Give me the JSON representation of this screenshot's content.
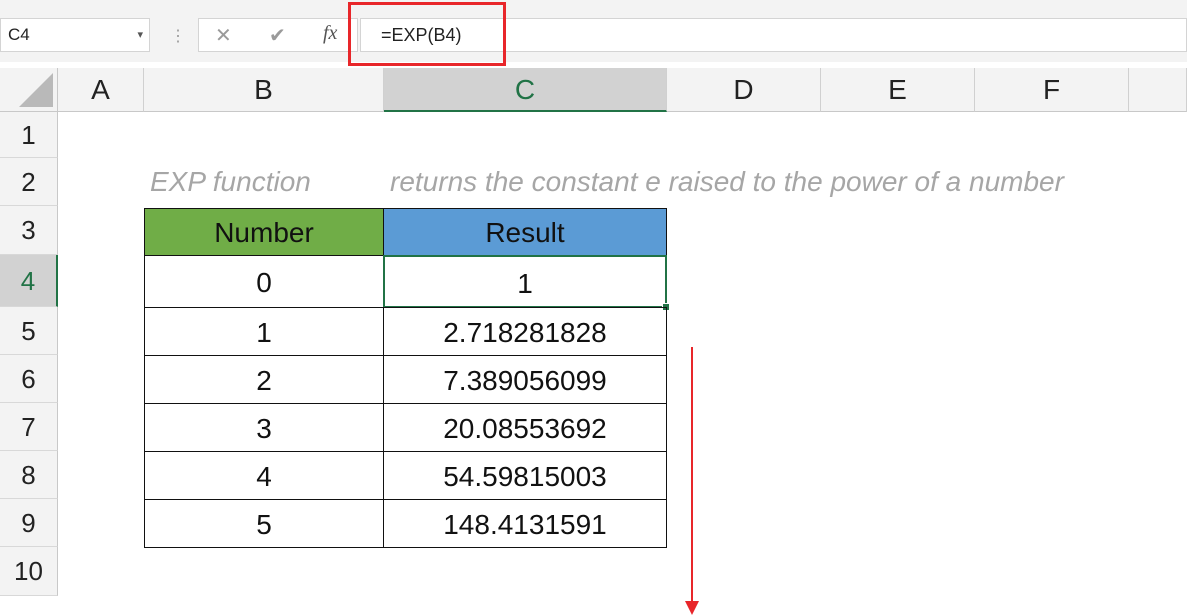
{
  "formula_bar": {
    "name_box": "C4",
    "name_box_arrow": "▾",
    "divider_dots": "⋮",
    "cancel_glyph": "✕",
    "enter_glyph": "✔",
    "fx_glyph": "fx",
    "formula": "=EXP(B4)"
  },
  "columns": [
    "A",
    "B",
    "C",
    "D",
    "E",
    "F"
  ],
  "active_column": "C",
  "rows": [
    "1",
    "2",
    "3",
    "4",
    "5",
    "6",
    "7",
    "8",
    "9",
    "10"
  ],
  "active_row": "4",
  "notes": {
    "function_name": "EXP function",
    "description": "returns the constant e raised to the power of a number"
  },
  "table": {
    "headers": {
      "number": "Number",
      "result": "Result"
    },
    "rows": [
      {
        "number": "0",
        "result": "1"
      },
      {
        "number": "1",
        "result": "2.718281828"
      },
      {
        "number": "2",
        "result": "7.389056099"
      },
      {
        "number": "3",
        "result": "20.08553692"
      },
      {
        "number": "4",
        "result": "54.59815003"
      },
      {
        "number": "5",
        "result": "148.4131591"
      }
    ]
  },
  "colors": {
    "number_header": "#70ad47",
    "result_header": "#5b9bd5",
    "selection": "#217346",
    "annotation": "#e8262a"
  }
}
